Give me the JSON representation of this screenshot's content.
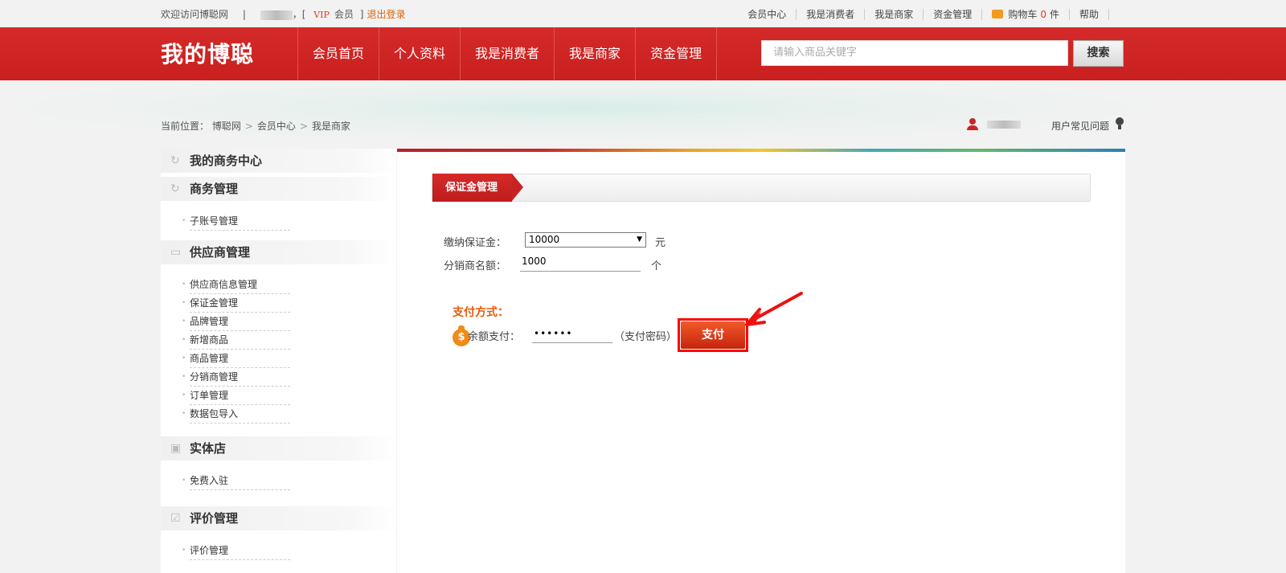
{
  "topbar": {
    "welcome": "欢迎访问博聪网",
    "separator": "|",
    "comma_bracket": "，[",
    "vip": "VIP",
    "member": "会员",
    "close_bracket": "]",
    "logout": "退出登录",
    "links": {
      "member_center": "会员中心",
      "consumer": "我是消费者",
      "merchant": "我是商家",
      "funds": "资金管理",
      "cart": "购物车",
      "cart_count": "0",
      "cart_unit": "件",
      "help": "帮助"
    }
  },
  "header": {
    "brand": "我的博聪",
    "nav": [
      "会员首页",
      "个人资料",
      "我是消费者",
      "我是商家",
      "资金管理"
    ],
    "search_placeholder": "请输入商品关键字",
    "search_button": "搜索"
  },
  "breadcrumb": {
    "prefix": "当前位置：",
    "items": [
      "博聪网",
      "会员中心",
      "我是商家"
    ],
    "gt": ">"
  },
  "user_bar": {
    "faq": "用户常见问题"
  },
  "sidebar": {
    "title": "我的商务中心",
    "sections": [
      {
        "title": "商务管理",
        "items": [
          "子账号管理"
        ]
      },
      {
        "title": "供应商管理",
        "items": [
          "供应商信息管理",
          "保证金管理",
          "品牌管理",
          "新增商品",
          "商品管理",
          "分销商管理",
          "订单管理",
          "数据包导入"
        ]
      },
      {
        "title": "实体店",
        "items": [
          "免费入驻"
        ]
      },
      {
        "title": "评价管理",
        "items": [
          "评价管理"
        ]
      }
    ]
  },
  "main": {
    "tab": "保证金管理",
    "deposit_label": "缴纳保证金：",
    "deposit_value": "10000",
    "deposit_unit": "元",
    "quota_label": "分销商名额：",
    "quota_value": "1000",
    "quota_unit": "个",
    "payment_title": "支付方式：",
    "balance_label": "余额支付：",
    "password_value": "••••••",
    "password_hint": "（支付密码）",
    "pay_button": "支付"
  },
  "colors": {
    "brand_red": "#c91f1f",
    "accent_orange": "#e85a0a",
    "highlight_box": "#ff0000"
  }
}
